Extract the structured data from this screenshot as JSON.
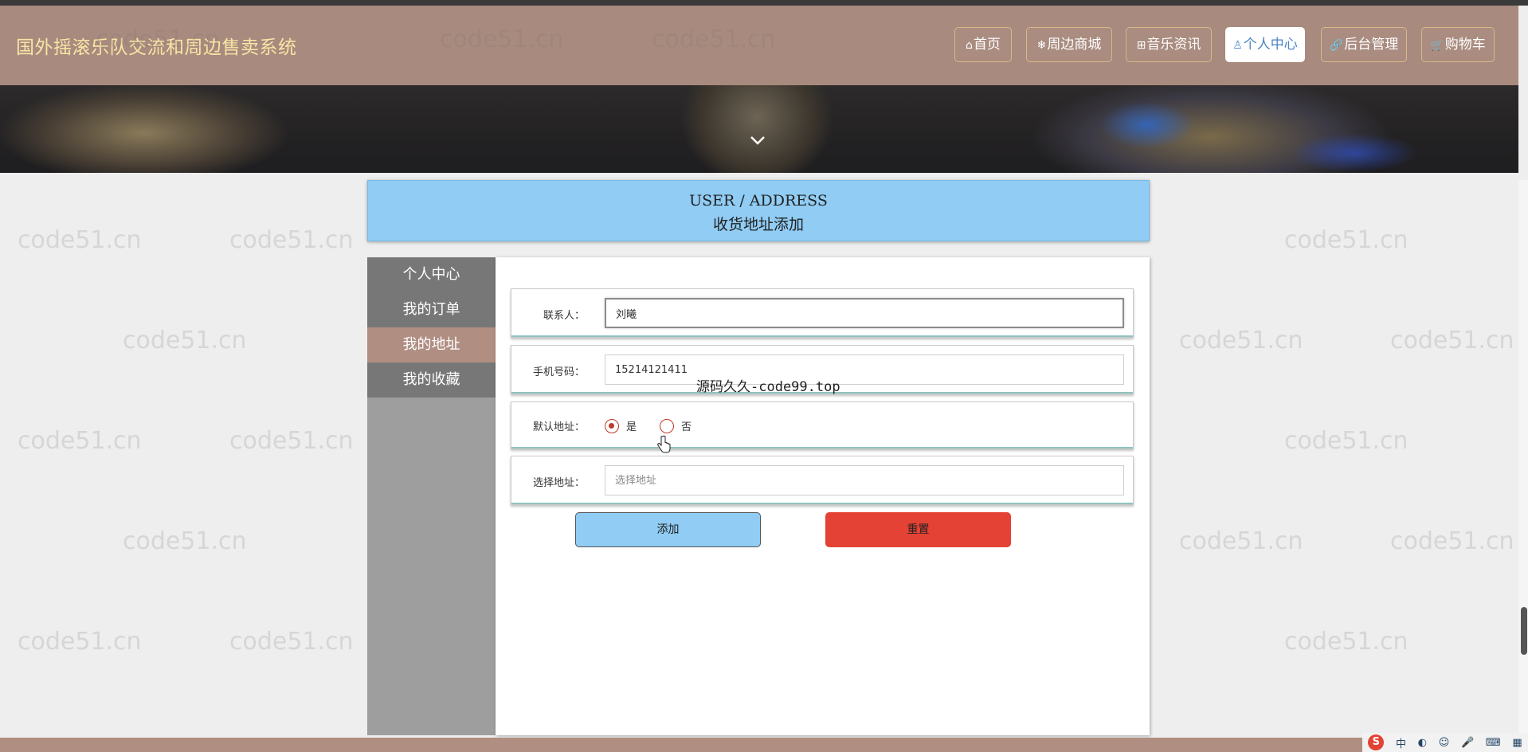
{
  "app": {
    "title": "国外摇滚乐队交流和周边售卖系统"
  },
  "nav": {
    "items": [
      {
        "icon": "home-icon",
        "glyph": "⌂",
        "label": "首页"
      },
      {
        "icon": "snowflake-icon",
        "glyph": "❄",
        "label": "周边商城"
      },
      {
        "icon": "bars-icon",
        "glyph": "⊞",
        "label": "音乐资讯"
      },
      {
        "icon": "user-icon",
        "glyph": "♙",
        "label": "个人中心",
        "active": true
      },
      {
        "icon": "link-icon",
        "glyph": "🔗",
        "label": "后台管理"
      },
      {
        "icon": "cart-icon",
        "glyph": "🛒",
        "label": "购物车"
      }
    ]
  },
  "page_header": {
    "title_en": "USER / ADDRESS",
    "title_zh": "收货地址添加"
  },
  "sidebar": {
    "items": [
      {
        "label": "个人中心"
      },
      {
        "label": "我的订单"
      },
      {
        "label": "我的地址",
        "active": true
      },
      {
        "label": "我的收藏"
      }
    ]
  },
  "form": {
    "contact": {
      "label": "联系人：",
      "value": "刘曦"
    },
    "phone": {
      "label": "手机号码：",
      "value": "15214121411"
    },
    "default": {
      "label": "默认地址：",
      "yes": "是",
      "no": "否",
      "selected": "yes"
    },
    "address": {
      "label": "选择地址：",
      "placeholder": "选择地址"
    },
    "add_label": "添加",
    "reset_label": "重置"
  },
  "overlay": {
    "text": "源码久久-code99.top"
  },
  "watermark": "code51.cn",
  "tray": {
    "sogou": "S",
    "lang": "中"
  },
  "colors": {
    "header": "#a98a7e",
    "title_gold": "#f7e6a6",
    "accent_blue": "#90ccf4",
    "reset_red": "#e34234",
    "sidebar_active": "#b08e82"
  }
}
